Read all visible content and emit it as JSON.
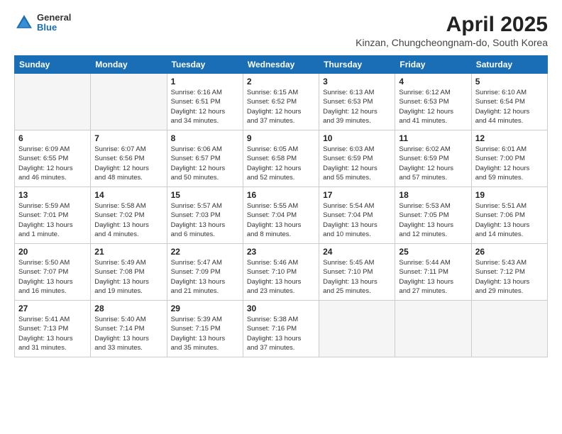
{
  "header": {
    "logo_line1": "General",
    "logo_line2": "Blue",
    "title": "April 2025",
    "subtitle": "Kinzan, Chungcheongnam-do, South Korea"
  },
  "weekdays": [
    "Sunday",
    "Monday",
    "Tuesday",
    "Wednesday",
    "Thursday",
    "Friday",
    "Saturday"
  ],
  "weeks": [
    [
      {
        "day": "",
        "info": ""
      },
      {
        "day": "",
        "info": ""
      },
      {
        "day": "1",
        "info": "Sunrise: 6:16 AM\nSunset: 6:51 PM\nDaylight: 12 hours\nand 34 minutes."
      },
      {
        "day": "2",
        "info": "Sunrise: 6:15 AM\nSunset: 6:52 PM\nDaylight: 12 hours\nand 37 minutes."
      },
      {
        "day": "3",
        "info": "Sunrise: 6:13 AM\nSunset: 6:53 PM\nDaylight: 12 hours\nand 39 minutes."
      },
      {
        "day": "4",
        "info": "Sunrise: 6:12 AM\nSunset: 6:53 PM\nDaylight: 12 hours\nand 41 minutes."
      },
      {
        "day": "5",
        "info": "Sunrise: 6:10 AM\nSunset: 6:54 PM\nDaylight: 12 hours\nand 44 minutes."
      }
    ],
    [
      {
        "day": "6",
        "info": "Sunrise: 6:09 AM\nSunset: 6:55 PM\nDaylight: 12 hours\nand 46 minutes."
      },
      {
        "day": "7",
        "info": "Sunrise: 6:07 AM\nSunset: 6:56 PM\nDaylight: 12 hours\nand 48 minutes."
      },
      {
        "day": "8",
        "info": "Sunrise: 6:06 AM\nSunset: 6:57 PM\nDaylight: 12 hours\nand 50 minutes."
      },
      {
        "day": "9",
        "info": "Sunrise: 6:05 AM\nSunset: 6:58 PM\nDaylight: 12 hours\nand 52 minutes."
      },
      {
        "day": "10",
        "info": "Sunrise: 6:03 AM\nSunset: 6:59 PM\nDaylight: 12 hours\nand 55 minutes."
      },
      {
        "day": "11",
        "info": "Sunrise: 6:02 AM\nSunset: 6:59 PM\nDaylight: 12 hours\nand 57 minutes."
      },
      {
        "day": "12",
        "info": "Sunrise: 6:01 AM\nSunset: 7:00 PM\nDaylight: 12 hours\nand 59 minutes."
      }
    ],
    [
      {
        "day": "13",
        "info": "Sunrise: 5:59 AM\nSunset: 7:01 PM\nDaylight: 13 hours\nand 1 minute."
      },
      {
        "day": "14",
        "info": "Sunrise: 5:58 AM\nSunset: 7:02 PM\nDaylight: 13 hours\nand 4 minutes."
      },
      {
        "day": "15",
        "info": "Sunrise: 5:57 AM\nSunset: 7:03 PM\nDaylight: 13 hours\nand 6 minutes."
      },
      {
        "day": "16",
        "info": "Sunrise: 5:55 AM\nSunset: 7:04 PM\nDaylight: 13 hours\nand 8 minutes."
      },
      {
        "day": "17",
        "info": "Sunrise: 5:54 AM\nSunset: 7:04 PM\nDaylight: 13 hours\nand 10 minutes."
      },
      {
        "day": "18",
        "info": "Sunrise: 5:53 AM\nSunset: 7:05 PM\nDaylight: 13 hours\nand 12 minutes."
      },
      {
        "day": "19",
        "info": "Sunrise: 5:51 AM\nSunset: 7:06 PM\nDaylight: 13 hours\nand 14 minutes."
      }
    ],
    [
      {
        "day": "20",
        "info": "Sunrise: 5:50 AM\nSunset: 7:07 PM\nDaylight: 13 hours\nand 16 minutes."
      },
      {
        "day": "21",
        "info": "Sunrise: 5:49 AM\nSunset: 7:08 PM\nDaylight: 13 hours\nand 19 minutes."
      },
      {
        "day": "22",
        "info": "Sunrise: 5:47 AM\nSunset: 7:09 PM\nDaylight: 13 hours\nand 21 minutes."
      },
      {
        "day": "23",
        "info": "Sunrise: 5:46 AM\nSunset: 7:10 PM\nDaylight: 13 hours\nand 23 minutes."
      },
      {
        "day": "24",
        "info": "Sunrise: 5:45 AM\nSunset: 7:10 PM\nDaylight: 13 hours\nand 25 minutes."
      },
      {
        "day": "25",
        "info": "Sunrise: 5:44 AM\nSunset: 7:11 PM\nDaylight: 13 hours\nand 27 minutes."
      },
      {
        "day": "26",
        "info": "Sunrise: 5:43 AM\nSunset: 7:12 PM\nDaylight: 13 hours\nand 29 minutes."
      }
    ],
    [
      {
        "day": "27",
        "info": "Sunrise: 5:41 AM\nSunset: 7:13 PM\nDaylight: 13 hours\nand 31 minutes."
      },
      {
        "day": "28",
        "info": "Sunrise: 5:40 AM\nSunset: 7:14 PM\nDaylight: 13 hours\nand 33 minutes."
      },
      {
        "day": "29",
        "info": "Sunrise: 5:39 AM\nSunset: 7:15 PM\nDaylight: 13 hours\nand 35 minutes."
      },
      {
        "day": "30",
        "info": "Sunrise: 5:38 AM\nSunset: 7:16 PM\nDaylight: 13 hours\nand 37 minutes."
      },
      {
        "day": "",
        "info": ""
      },
      {
        "day": "",
        "info": ""
      },
      {
        "day": "",
        "info": ""
      }
    ]
  ]
}
